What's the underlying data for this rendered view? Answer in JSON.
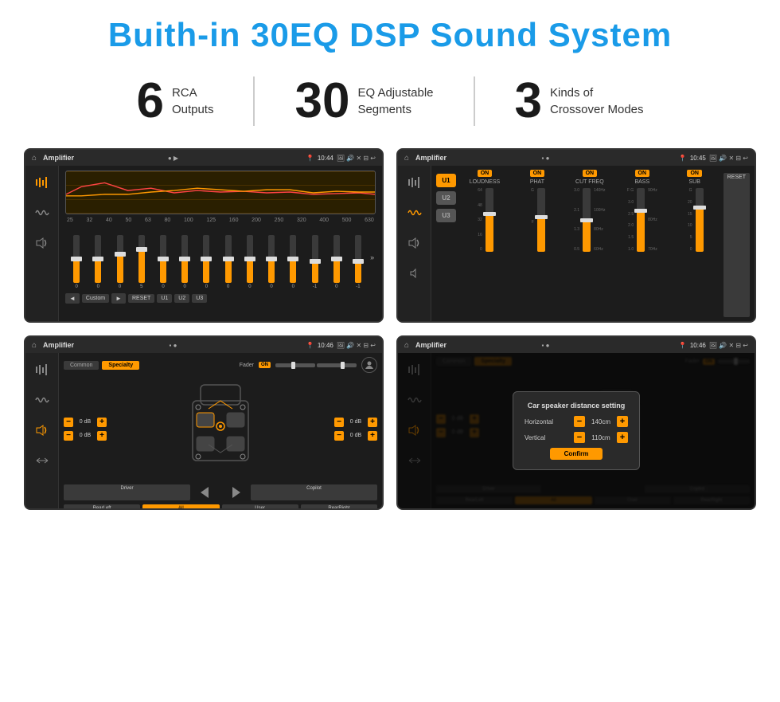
{
  "page": {
    "title": "Buith-in 30EQ DSP Sound System"
  },
  "stats": [
    {
      "number": "6",
      "line1": "RCA",
      "line2": "Outputs"
    },
    {
      "number": "30",
      "line1": "EQ Adjustable",
      "line2": "Segments"
    },
    {
      "number": "3",
      "line1": "Kinds of",
      "line2": "Crossover Modes"
    }
  ],
  "screens": [
    {
      "id": "screen1",
      "appName": "Amplifier",
      "time": "10:44",
      "eq_freqs": [
        "25",
        "32",
        "40",
        "50",
        "63",
        "80",
        "100",
        "125",
        "160",
        "200",
        "250",
        "320",
        "400",
        "500",
        "630"
      ],
      "eq_vals": [
        "0",
        "0",
        "0",
        "5",
        "0",
        "0",
        "0",
        "0",
        "0",
        "0",
        "0",
        "-1",
        "0",
        "-1"
      ],
      "bottom_buttons": [
        "Custom",
        "RESET",
        "U1",
        "U2",
        "U3"
      ]
    },
    {
      "id": "screen2",
      "appName": "Amplifier",
      "time": "10:45",
      "presets": [
        "U1",
        "U2",
        "U3"
      ],
      "groups": [
        "LOUDNESS",
        "PHAT",
        "CUT FREQ",
        "BASS",
        "SUB"
      ],
      "reset_label": "RESET"
    },
    {
      "id": "screen3",
      "appName": "Amplifier",
      "time": "10:46",
      "tabs": [
        "Common",
        "Specialty"
      ],
      "fader_label": "Fader",
      "fader_on": "ON",
      "db_rows": [
        {
          "value": "0 dB"
        },
        {
          "value": "0 dB"
        },
        {
          "value": "0 dB"
        },
        {
          "value": "0 dB"
        }
      ],
      "bottom_buttons": [
        "Driver",
        "",
        "Copilot",
        "RearLeft",
        "All",
        "User",
        "RearRight"
      ]
    },
    {
      "id": "screen4",
      "appName": "Amplifier",
      "time": "10:46",
      "tabs": [
        "Common",
        "Specialty"
      ],
      "dialog": {
        "title": "Car speaker distance setting",
        "horizontal_label": "Horizontal",
        "horizontal_value": "140cm",
        "vertical_label": "Vertical",
        "vertical_value": "110cm",
        "confirm_label": "Confirm"
      },
      "db_rows": [
        {
          "value": "0 dB"
        },
        {
          "value": "0 dB"
        }
      ],
      "bottom_buttons": [
        "Driver",
        "Copilot",
        "RearLeft",
        "User",
        "RearRight"
      ]
    }
  ]
}
